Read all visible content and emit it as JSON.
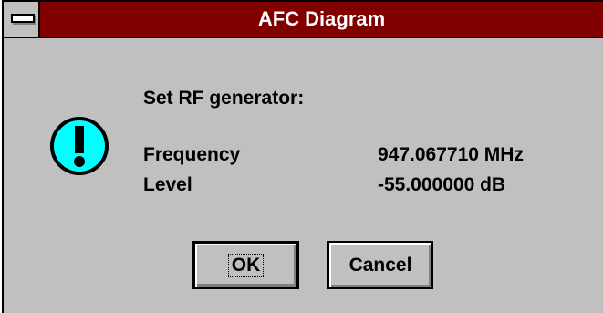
{
  "window": {
    "title": "AFC Diagram"
  },
  "message": {
    "prompt": "Set RF generator:",
    "rows": [
      {
        "label": "Frequency",
        "value": "947.067710 MHz"
      },
      {
        "label": "Level",
        "value": "-55.000000 dB"
      }
    ]
  },
  "buttons": {
    "ok": "OK",
    "cancel": "Cancel"
  },
  "icon": {
    "name": "exclamation-icon",
    "color": "#00ffff"
  }
}
